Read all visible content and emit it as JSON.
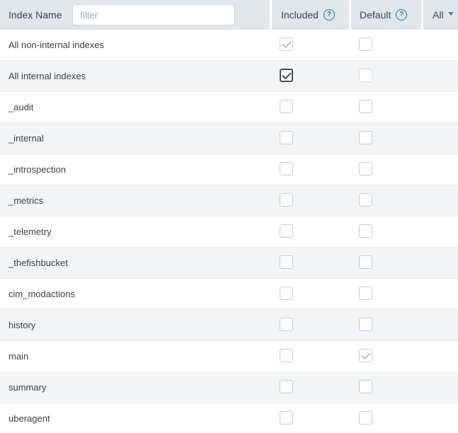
{
  "header": {
    "index_name_label": "Index Name",
    "filter_placeholder": "filter",
    "filter_value": "",
    "included_label": "Included",
    "default_label": "Default",
    "all_label": "All",
    "help_glyph": "?"
  },
  "colors": {
    "header_bg": "#e1e6eb",
    "alt_row_bg": "#f2f4f5",
    "help_icon_blue": "#1a7fb5",
    "text": "#3c444d",
    "checkbox_border": "#c3ccd6",
    "checked_dark": "#434c55",
    "disabled_check": "#b5c2cf"
  },
  "rows": [
    {
      "name": "All non-internal indexes",
      "included": "checked-disabled",
      "default": "unchecked"
    },
    {
      "name": "All internal indexes",
      "included": "checked",
      "default": "unchecked-disabled"
    },
    {
      "name": "_audit",
      "included": "unchecked",
      "default": "unchecked"
    },
    {
      "name": "_internal",
      "included": "unchecked",
      "default": "unchecked"
    },
    {
      "name": "_introspection",
      "included": "unchecked",
      "default": "unchecked"
    },
    {
      "name": "_metrics",
      "included": "unchecked",
      "default": "unchecked"
    },
    {
      "name": "_telemetry",
      "included": "unchecked",
      "default": "unchecked"
    },
    {
      "name": "_thefishbucket",
      "included": "unchecked",
      "default": "unchecked"
    },
    {
      "name": "cim_modactions",
      "included": "unchecked",
      "default": "unchecked"
    },
    {
      "name": "history",
      "included": "unchecked",
      "default": "unchecked"
    },
    {
      "name": "main",
      "included": "unchecked",
      "default": "checked-disabled"
    },
    {
      "name": "summary",
      "included": "unchecked",
      "default": "unchecked"
    },
    {
      "name": "uberagent",
      "included": "unchecked",
      "default": "unchecked"
    }
  ]
}
